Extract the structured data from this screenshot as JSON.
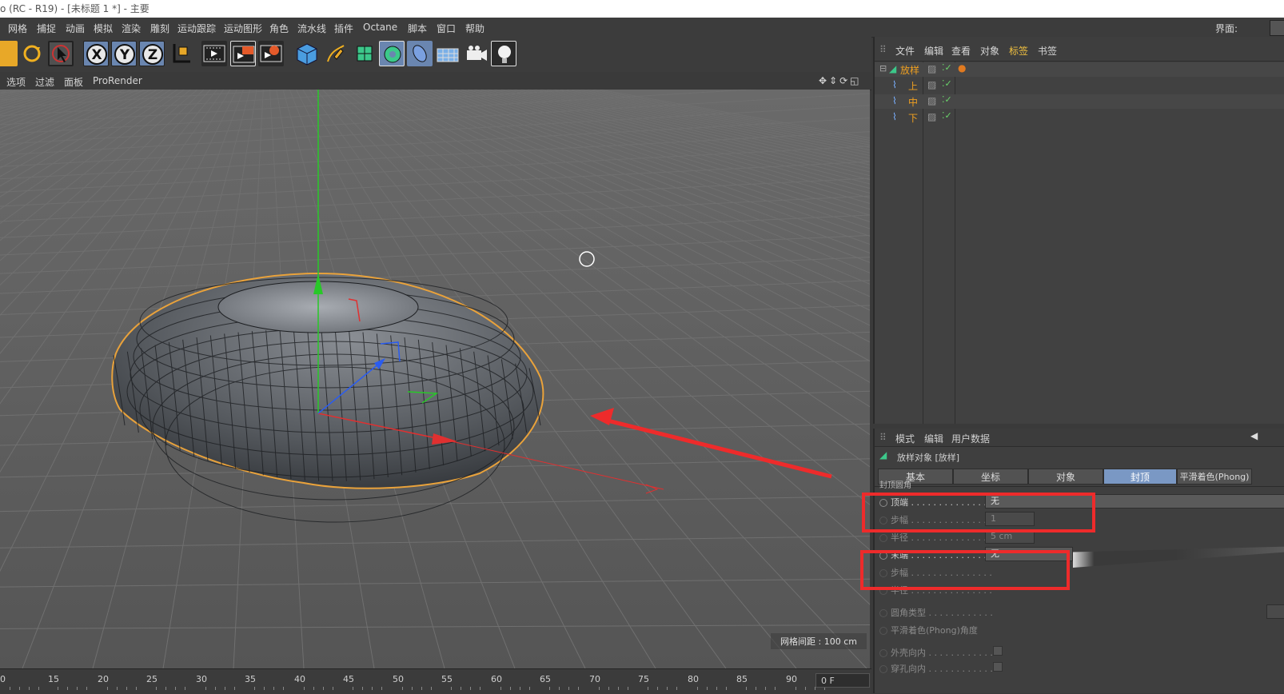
{
  "title": "o (RC - R19) - [未标题 1 *] - 主要",
  "topright_label": "界面:",
  "menu": [
    "网格",
    "捕捉",
    "动画",
    "模拟",
    "渲染",
    "雕刻",
    "运动跟踪",
    "运动图形",
    "角色",
    "流水线",
    "插件",
    "Octane",
    "脚本",
    "窗口",
    "帮助"
  ],
  "viewport_menu": [
    "选项",
    "过滤",
    "面板",
    "ProRender"
  ],
  "grid_label": "网格间距 : 100 cm",
  "object_manager": {
    "menu": [
      "文件",
      "编辑",
      "查看",
      "对象",
      "标签",
      "书签"
    ],
    "objects": [
      {
        "name": "放样",
        "type": "loft"
      },
      {
        "name": "上",
        "type": "spline"
      },
      {
        "name": "中",
        "type": "spline"
      },
      {
        "name": "下",
        "type": "spline"
      }
    ]
  },
  "attributes": {
    "menu": [
      "模式",
      "编辑",
      "用户数据"
    ],
    "object_title": "放样对象 [放样]",
    "tabs": [
      "基本",
      "坐标",
      "对象",
      "封顶",
      "平滑着色(Phong)"
    ],
    "active_tab": "封顶",
    "section": "封顶圆角",
    "rows": [
      {
        "label": "顶端 . . . . . . . . . . . . . . .",
        "value": "无",
        "enabled": true
      },
      {
        "label": "步幅 . . . . . . . . . . . . . . .",
        "value": "1",
        "enabled": false
      },
      {
        "label": "半径 . . . . . . . . . . . . . . .",
        "value": "5 cm",
        "enabled": false
      },
      {
        "label": "末端 . . . . . . . . . . . . . . .",
        "value": "无",
        "enabled": true
      },
      {
        "label": "步幅 . . . . . . . . . . . . . . .",
        "value": "",
        "enabled": false
      },
      {
        "label": "半径 . . . . . . . . . . . . . . .",
        "value": "",
        "enabled": false
      },
      {
        "label": "圆角类型 . . . . . . . . . . . .",
        "value": "",
        "enabled": false
      },
      {
        "label": "平滑着色(Phong)角度",
        "value": "",
        "enabled": false
      },
      {
        "label": "外壳向内 . . . . . . . . . . . .",
        "value": "",
        "enabled": false
      },
      {
        "label": "穿孔向内 . . . . . . . . . . . .",
        "value": "",
        "enabled": false
      }
    ]
  },
  "timeline": {
    "ticks": [
      "0",
      "15",
      "20",
      "25",
      "30",
      "35",
      "40",
      "45",
      "50",
      "55",
      "60",
      "65",
      "70",
      "75",
      "80",
      "85",
      "90"
    ],
    "frame": "0 F"
  },
  "colors": {
    "accent": "#7a98c4",
    "highlight_box": "#ee2b2b",
    "selection_orange": "#e9a23b"
  }
}
